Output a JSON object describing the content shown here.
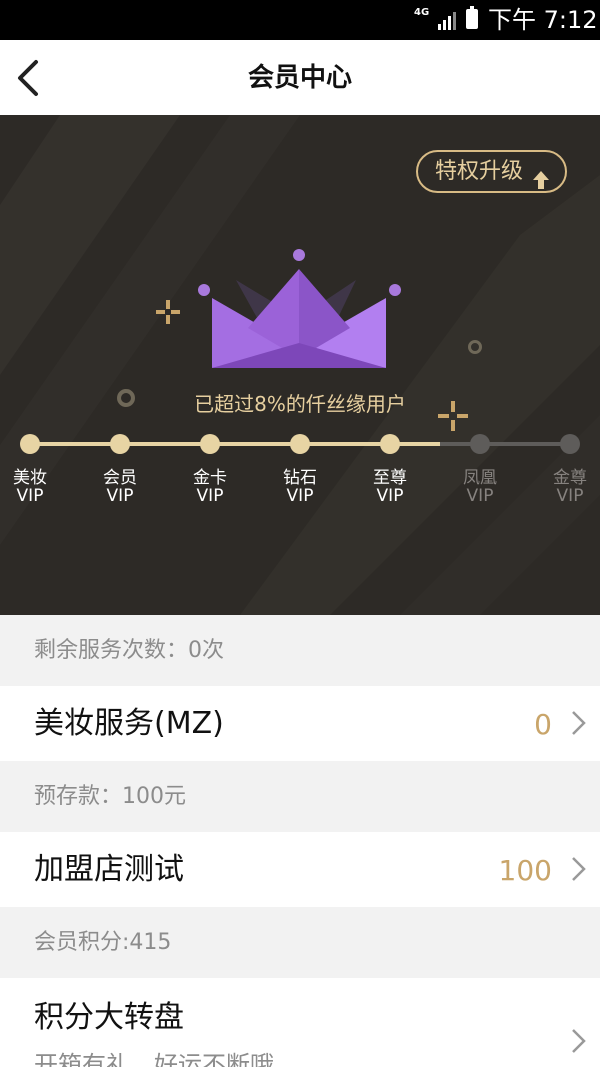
{
  "status_bar": {
    "network": "4G",
    "time": "下午 7:12"
  },
  "nav": {
    "title": "会员中心"
  },
  "hero": {
    "upgrade_label": "特权升级",
    "exceed_text": "已超过8%的仟丝缘用户",
    "progress": 0.76,
    "levels": [
      {
        "name": "美妆",
        "vip": "VIP",
        "active": true
      },
      {
        "name": "会员",
        "vip": "VIP",
        "active": true
      },
      {
        "name": "金卡",
        "vip": "VIP",
        "active": true
      },
      {
        "name": "钻石",
        "vip": "VIP",
        "active": true
      },
      {
        "name": "至尊",
        "vip": "VIP",
        "active": true
      },
      {
        "name": "凤凰",
        "vip": "VIP",
        "active": false
      },
      {
        "name": "金尊",
        "vip": "VIP",
        "active": false
      }
    ]
  },
  "sections": {
    "remaining_services": "剩余服务次数：0次",
    "beauty_service": {
      "label": "美妆服务(MZ)",
      "value": "0"
    },
    "deposit": "预存款：100元",
    "franchise": {
      "label": "加盟店测试",
      "value": "100"
    },
    "points": "会员积分:415",
    "wheel": {
      "label": "积分大转盘",
      "sub": "开箱有礼，好运不断哦"
    }
  },
  "colors": {
    "accent_gold": "#e7d4a4",
    "value_gold": "#c9a56a",
    "crown_purple": "#9b6fd4",
    "hero_bg": "#2d2a26"
  }
}
